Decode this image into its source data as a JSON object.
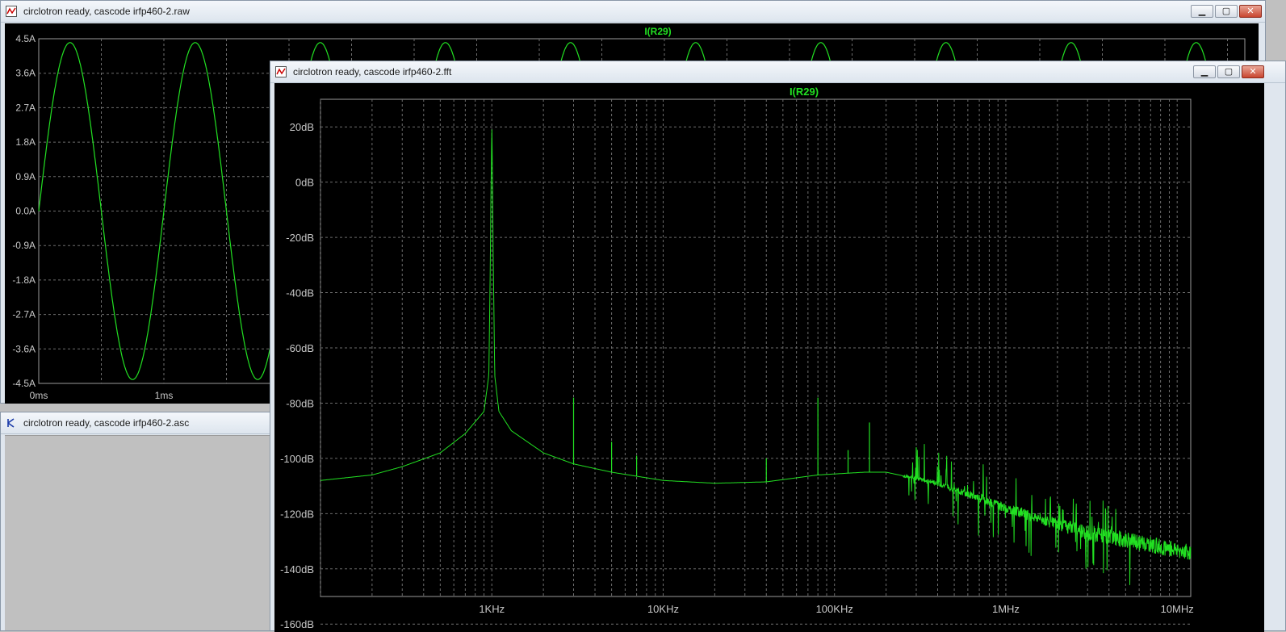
{
  "window_raw": {
    "title": "circlotron ready, cascode irfp460-2.raw",
    "trace_label": "I(R29)",
    "y_ticks": [
      "4.5A",
      "3.6A",
      "2.7A",
      "1.8A",
      "0.9A",
      "0.0A",
      "-0.9A",
      "-1.8A",
      "-2.7A",
      "-3.6A",
      "-4.5A"
    ],
    "x_ticks": [
      "0ms",
      "1ms"
    ]
  },
  "window_asc": {
    "title": "circlotron ready, cascode irfp460-2.asc"
  },
  "window_fft": {
    "title": "circlotron ready, cascode irfp460-2.fft",
    "trace_label": "I(R29)",
    "y_ticks": [
      "20dB",
      "0dB",
      "-20dB",
      "-40dB",
      "-60dB",
      "-80dB",
      "-100dB",
      "-120dB",
      "-140dB",
      "-160dB"
    ],
    "x_ticks": [
      "1KHz",
      "10KHz",
      "100KHz",
      "1MHz",
      "10MHz"
    ]
  },
  "window_controls": {
    "minimize_glyph": "▁",
    "maximize_glyph": "▢",
    "close_glyph": "✕"
  },
  "colors": {
    "trace": "#22e022",
    "grid": "#6e6e6e",
    "axis_text": "#c8c8c8",
    "trace_label": "#22e022",
    "plot_bg": "#000000"
  },
  "chart_data": [
    {
      "type": "line",
      "title": "I(R29)",
      "xlabel": "",
      "ylabel": "",
      "x_unit": "ms",
      "y_unit": "A",
      "xlim": [
        0,
        1.8
      ],
      "ylim": [
        -4.5,
        4.5
      ],
      "grid": true,
      "series": [
        {
          "name": "I(R29)",
          "shape": "sine",
          "amplitude_A": 4.4,
          "frequency_kHz": 1,
          "phase_start_A": 0.0
        }
      ]
    },
    {
      "type": "line",
      "title": "I(R29)",
      "xlabel": "",
      "ylabel": "",
      "x_scale": "log",
      "x_unit": "Hz",
      "y_unit": "dB",
      "xlim": [
        100,
        12000000
      ],
      "ylim": [
        -160,
        20
      ],
      "grid": true,
      "series": [
        {
          "name": "I(R29)",
          "baseline_points": [
            [
              100,
              -118
            ],
            [
              200,
              -116
            ],
            [
              300,
              -113
            ],
            [
              500,
              -108
            ],
            [
              700,
              -101
            ],
            [
              900,
              -93
            ],
            [
              960,
              -80
            ],
            [
              980,
              -40
            ],
            [
              990,
              -10
            ],
            [
              1000,
              10
            ],
            [
              1010,
              -10
            ],
            [
              1020,
              -40
            ],
            [
              1040,
              -80
            ],
            [
              1100,
              -93
            ],
            [
              1300,
              -100
            ],
            [
              2000,
              -108
            ],
            [
              3000,
              -112
            ],
            [
              5000,
              -115
            ],
            [
              10000,
              -118
            ],
            [
              20000,
              -119
            ],
            [
              40000,
              -118.5
            ],
            [
              80000,
              -116
            ],
            [
              150000,
              -115
            ],
            [
              200000,
              -115
            ],
            [
              400000,
              -119
            ],
            [
              1000000,
              -128
            ],
            [
              3000000,
              -137
            ],
            [
              12000000,
              -144
            ]
          ],
          "spurs": [
            [
              3000,
              -88
            ],
            [
              5000,
              -104
            ],
            [
              7000,
              -109
            ],
            [
              40000,
              -110
            ],
            [
              80000,
              -88
            ],
            [
              120000,
              -107
            ],
            [
              160000,
              -97
            ],
            [
              300000,
              -106
            ]
          ]
        }
      ]
    }
  ]
}
